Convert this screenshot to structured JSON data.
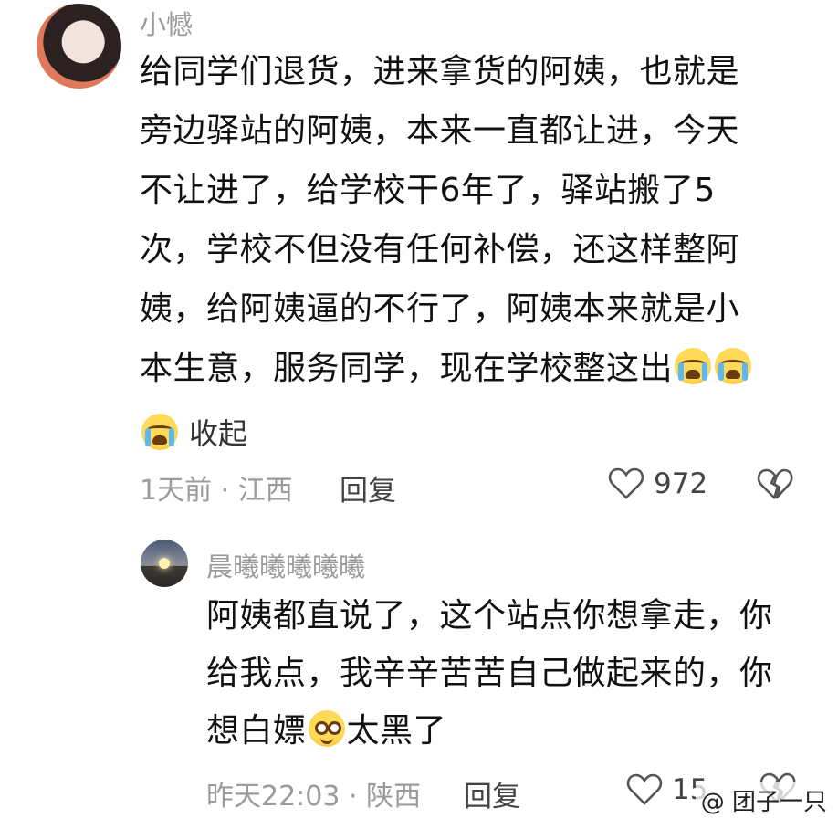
{
  "comment": {
    "username": "小憾",
    "lines": [
      "给同学们退货，进来拿货的阿姨，也就是",
      "旁边驿站的阿姨，本来一直都让进，今天",
      "不让进了，给学校干6年了，驿站搬了5",
      "次，学校不但没有任何补偿，还这样整阿",
      "姨，给阿姨逼的不行了，阿姨本来就是小",
      "本生意，服务同学，现在学校整这出"
    ],
    "collapse_label": "收起",
    "time_location": "1天前 · 江西",
    "reply_label": "回复",
    "like_count": "972"
  },
  "reply": {
    "username": "晨曦曦曦曦曦",
    "lines": [
      "阿姨都直说了，这个站点你想拿走，你",
      "给我点，我辛辛苦苦自己做起来的，你",
      "想白嫖",
      "太黑了"
    ],
    "time_location": "昨天22:03 · 陕西",
    "reply_label": "回复",
    "like_count": "15"
  },
  "watermark": {
    "text": "@ 团子一只"
  },
  "icons": {
    "crying_emoji": "crying-face-emoji",
    "laughing_emoji": "grinning-squint-emoji",
    "heart": "heart-outline-icon",
    "broken_heart": "broken-heart-icon"
  },
  "colors": {
    "meta_gray": "#9b9b9b",
    "text": "#111111",
    "emoji_yellow": "#ffd958"
  }
}
